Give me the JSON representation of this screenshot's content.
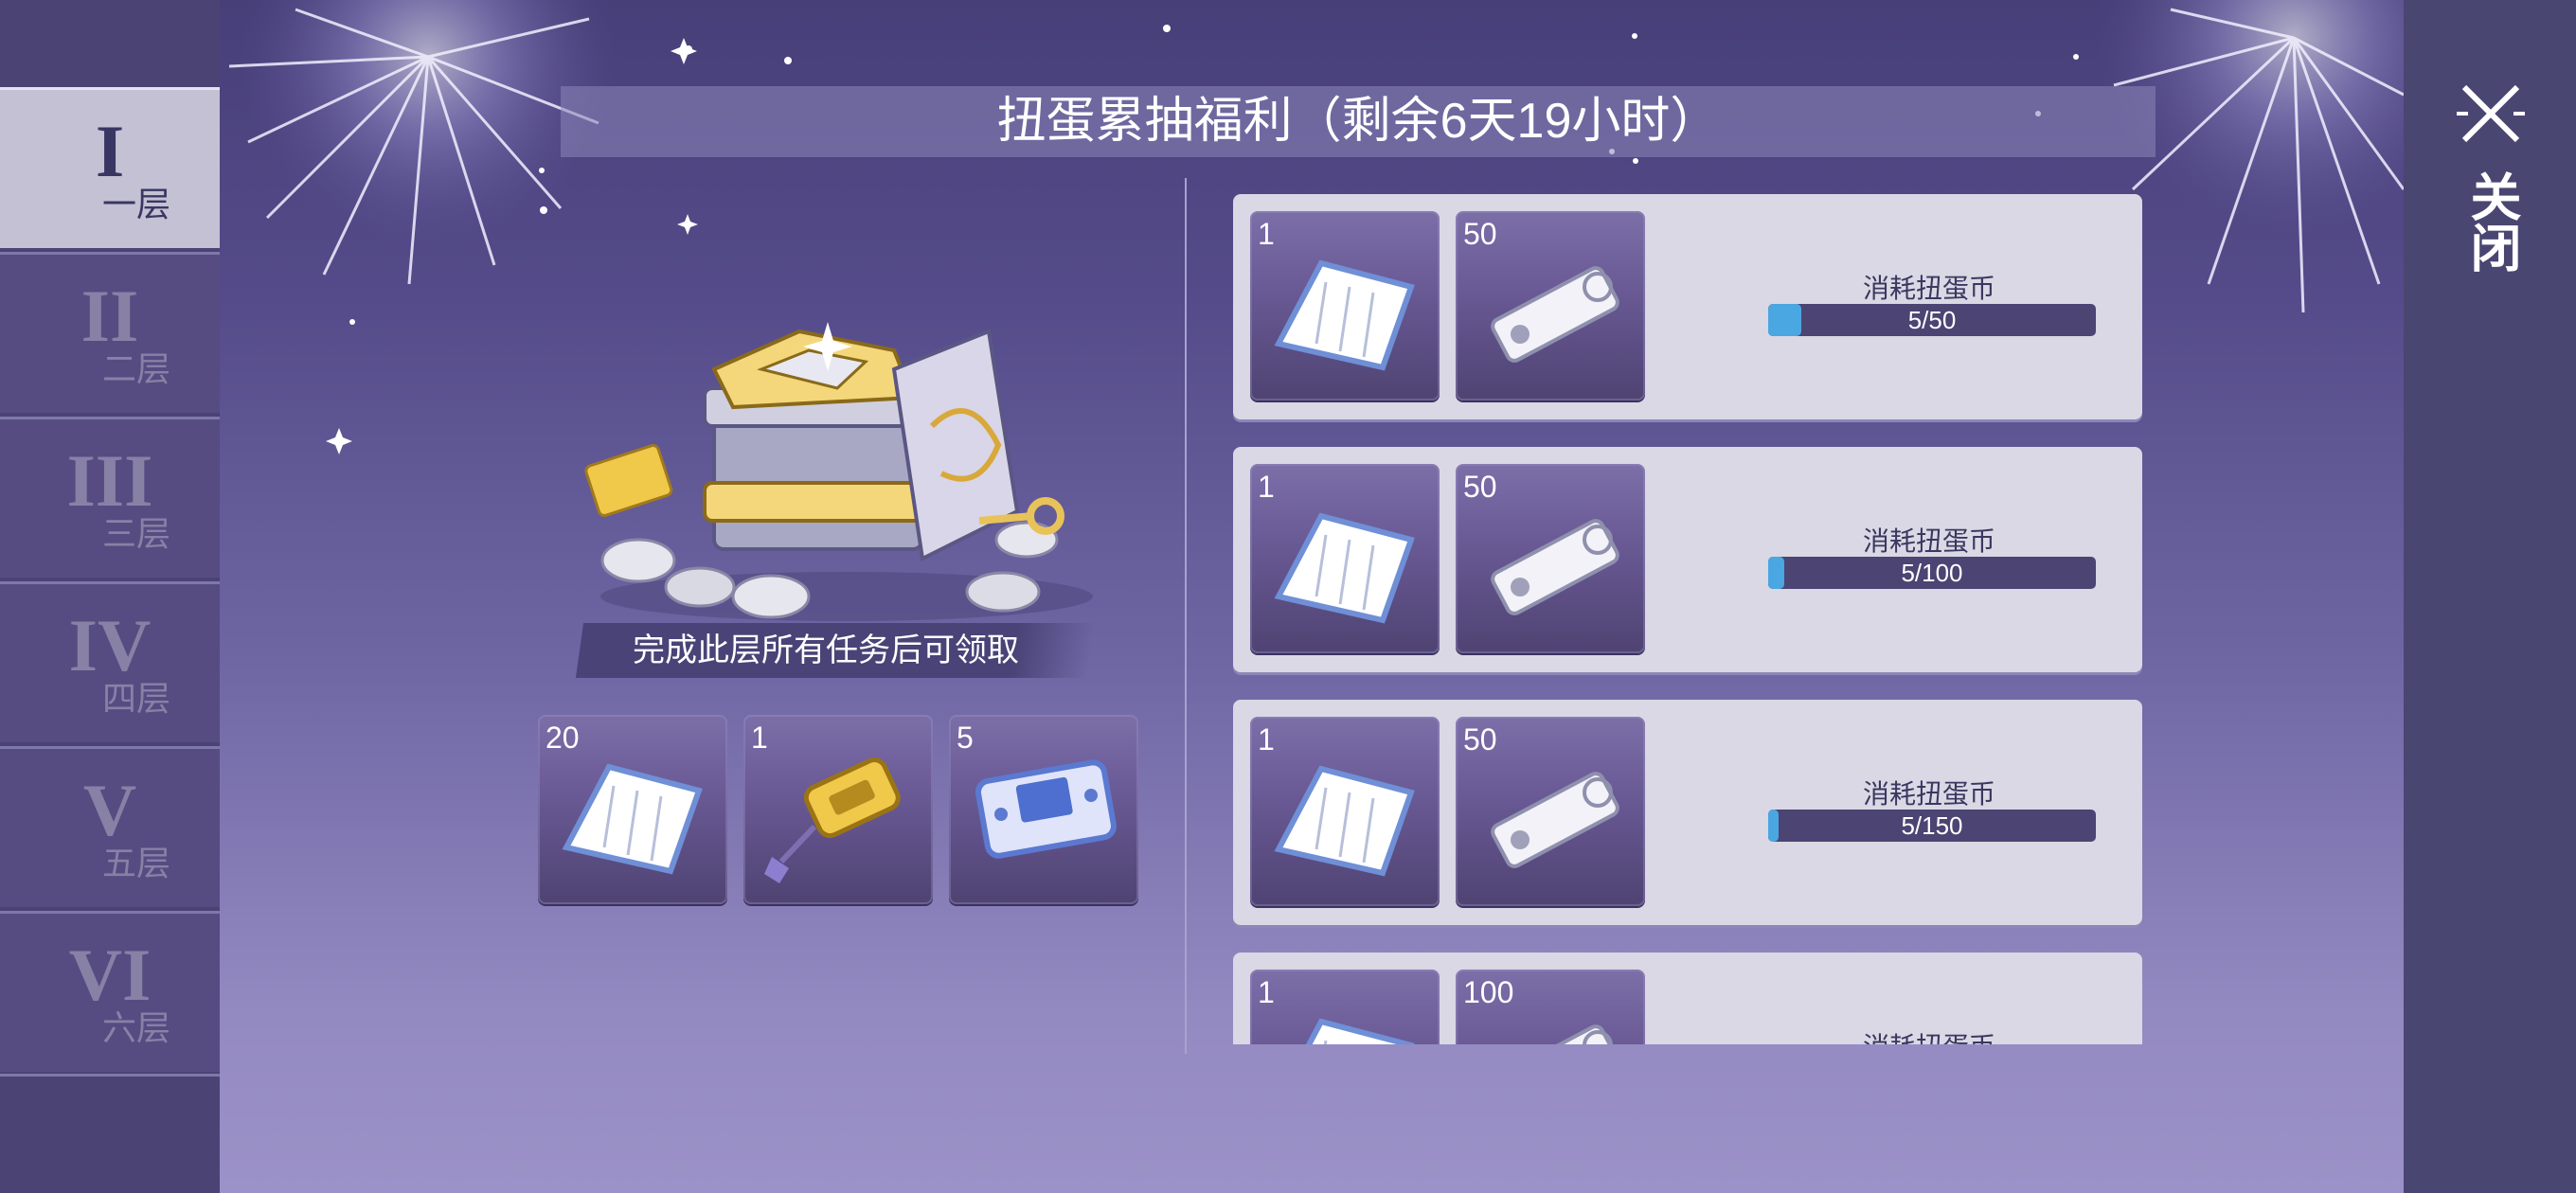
{
  "title": "扭蛋累抽福利（剩余6天19小时）",
  "floors": [
    {
      "roman": "I",
      "label": "一层",
      "active": true
    },
    {
      "roman": "II",
      "label": "二层",
      "active": false
    },
    {
      "roman": "III",
      "label": "三层",
      "active": false
    },
    {
      "roman": "IV",
      "label": "四层",
      "active": false
    },
    {
      "roman": "V",
      "label": "五层",
      "active": false
    },
    {
      "roman": "VI",
      "label": "六层",
      "active": false
    }
  ],
  "floor_reward": {
    "condition": "完成此层所有任务后可领取",
    "items": [
      {
        "qty": "20",
        "icon": "paper-scroll-icon"
      },
      {
        "qty": "1",
        "icon": "golden-tag-icon"
      },
      {
        "qty": "5",
        "icon": "blue-ticket-icon"
      }
    ]
  },
  "tasks": [
    {
      "label": "消耗扭蛋币",
      "progress": "5/50",
      "fraction": 0.1,
      "rewards": [
        {
          "qty": "1",
          "icon": "paper-scroll-icon"
        },
        {
          "qty": "50",
          "icon": "silver-ticket-icon"
        }
      ]
    },
    {
      "label": "消耗扭蛋币",
      "progress": "5/100",
      "fraction": 0.05,
      "rewards": [
        {
          "qty": "1",
          "icon": "paper-scroll-icon"
        },
        {
          "qty": "50",
          "icon": "silver-ticket-icon"
        }
      ]
    },
    {
      "label": "消耗扭蛋币",
      "progress": "5/150",
      "fraction": 0.033,
      "rewards": [
        {
          "qty": "1",
          "icon": "paper-scroll-icon"
        },
        {
          "qty": "50",
          "icon": "silver-ticket-icon"
        }
      ]
    },
    {
      "label": "消耗扭蛋币",
      "progress": "",
      "rewards": [
        {
          "qty": "1",
          "icon": "paper-scroll-icon"
        },
        {
          "qty": "100",
          "icon": "silver-ticket-icon"
        }
      ]
    }
  ],
  "close_label": "关闭",
  "colors": {
    "progress_fill": "#4aa7e2",
    "progress_track": "#4c4473",
    "active_tab": "#c3c1d3"
  }
}
